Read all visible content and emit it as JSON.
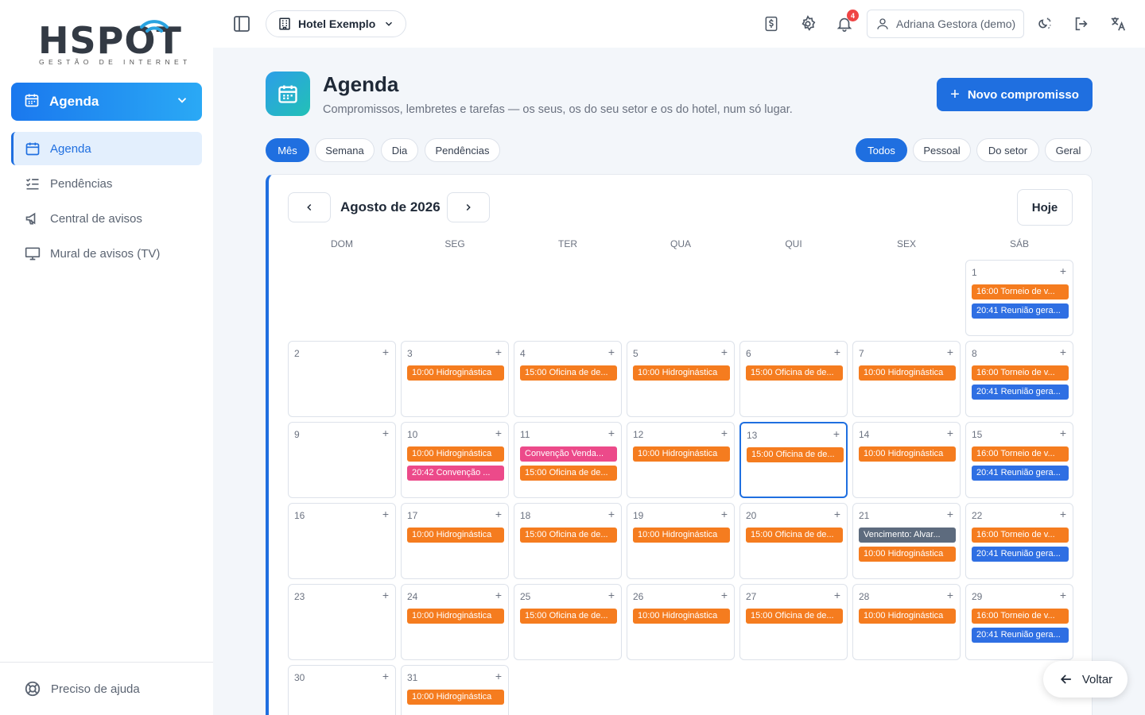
{
  "brand": {
    "name": "HSPOT",
    "tagline": "GESTÃO DE INTERNET"
  },
  "sidebar": {
    "module": {
      "label": "Agenda",
      "icon": "calendar-icon"
    },
    "items": [
      {
        "label": "Agenda",
        "icon": "calendar-icon",
        "active": true
      },
      {
        "label": "Pendências",
        "icon": "checklist-icon"
      },
      {
        "label": "Central de avisos",
        "icon": "megaphone-icon"
      },
      {
        "label": "Mural de avisos (TV)",
        "icon": "monitor-icon"
      }
    ],
    "help_label": "Preciso de ajuda"
  },
  "topbar": {
    "hotel": "Hotel Exemplo",
    "notifications_count": "4",
    "user": "Adriana Gestora (demo)"
  },
  "page": {
    "title": "Agenda",
    "subtitle": "Compromissos, lembretes e tarefas — os seus, os do seu setor e os do hotel, num só lugar.",
    "new_button": "Novo compromisso"
  },
  "view_tabs": [
    "Mês",
    "Semana",
    "Dia",
    "Pendências"
  ],
  "scope_tabs": [
    "Todos",
    "Pessoal",
    "Do setor",
    "Geral"
  ],
  "calendar": {
    "month_label": "Agosto de 2026",
    "today_button": "Hoje",
    "weekdays": [
      "DOM",
      "SEG",
      "TER",
      "QUA",
      "QUI",
      "SEX",
      "SÁB"
    ],
    "first_weekday": 6,
    "days_in_month": 31,
    "today": 13,
    "events": {
      "1": [
        [
          "16:00 Torneio de v...",
          "orange"
        ],
        [
          "20:41 Reunião gera...",
          "blue"
        ]
      ],
      "3": [
        [
          "10:00 Hidroginástica",
          "orange"
        ]
      ],
      "4": [
        [
          "15:00 Oficina de de...",
          "orange"
        ]
      ],
      "5": [
        [
          "10:00 Hidroginástica",
          "orange"
        ]
      ],
      "6": [
        [
          "15:00 Oficina de de...",
          "orange"
        ]
      ],
      "7": [
        [
          "10:00 Hidroginástica",
          "orange"
        ]
      ],
      "8": [
        [
          "16:00 Torneio de v...",
          "orange"
        ],
        [
          "20:41 Reunião gera...",
          "blue"
        ]
      ],
      "10": [
        [
          "10:00 Hidroginástica",
          "orange"
        ],
        [
          "20:42 Convenção ...",
          "pink"
        ]
      ],
      "11": [
        [
          "Convenção Venda...",
          "pink"
        ],
        [
          "15:00 Oficina de de...",
          "orange"
        ]
      ],
      "12": [
        [
          "10:00 Hidroginástica",
          "orange"
        ]
      ],
      "13": [
        [
          "15:00 Oficina de de...",
          "orange"
        ]
      ],
      "14": [
        [
          "10:00 Hidroginástica",
          "orange"
        ]
      ],
      "15": [
        [
          "16:00 Torneio de v...",
          "orange"
        ],
        [
          "20:41 Reunião gera...",
          "blue"
        ]
      ],
      "17": [
        [
          "10:00 Hidroginástica",
          "orange"
        ]
      ],
      "18": [
        [
          "15:00 Oficina de de...",
          "orange"
        ]
      ],
      "19": [
        [
          "10:00 Hidroginástica",
          "orange"
        ]
      ],
      "20": [
        [
          "15:00 Oficina de de...",
          "orange"
        ]
      ],
      "21": [
        [
          "Vencimento: Alvar...",
          "gray"
        ],
        [
          "10:00 Hidroginástica",
          "orange"
        ]
      ],
      "22": [
        [
          "16:00 Torneio de v...",
          "orange"
        ],
        [
          "20:41 Reunião gera...",
          "blue"
        ]
      ],
      "24": [
        [
          "10:00 Hidroginástica",
          "orange"
        ]
      ],
      "25": [
        [
          "15:00 Oficina de de...",
          "orange"
        ]
      ],
      "26": [
        [
          "10:00 Hidroginástica",
          "orange"
        ]
      ],
      "27": [
        [
          "15:00 Oficina de de...",
          "orange"
        ]
      ],
      "28": [
        [
          "10:00 Hidroginástica",
          "orange"
        ]
      ],
      "29": [
        [
          "16:00 Torneio de v...",
          "orange"
        ],
        [
          "20:41 Reunião gera...",
          "blue"
        ]
      ],
      "31": [
        [
          "10:00 Hidroginástica",
          "orange"
        ]
      ]
    }
  },
  "back_button": "Voltar",
  "colors": {
    "primary": "#1f6fe0",
    "orange": "#f57c1f",
    "blue": "#2f6fe3",
    "pink": "#ec4a8a",
    "gray": "#5d6b7e"
  }
}
